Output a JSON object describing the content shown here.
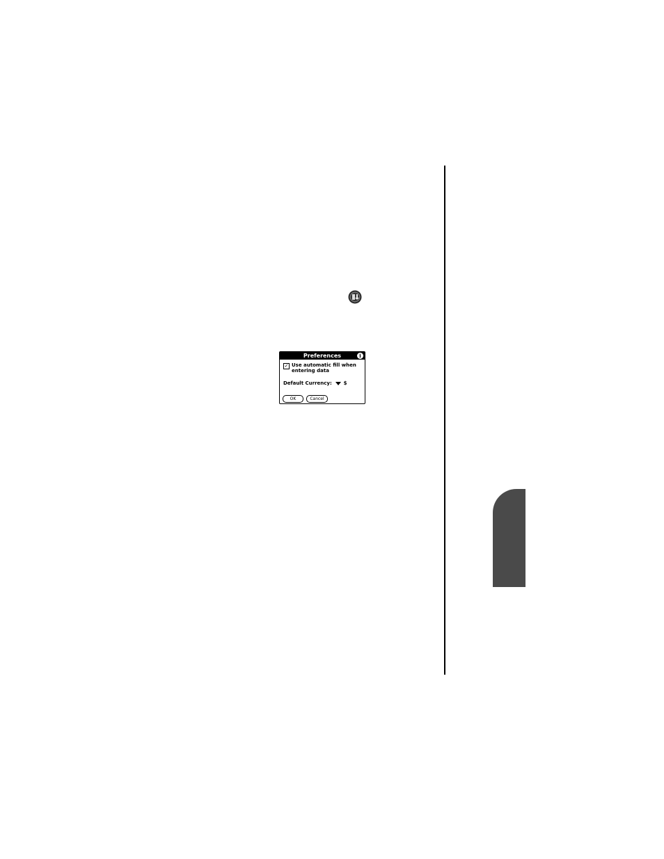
{
  "dialog": {
    "title": "Preferences",
    "info_glyph": "i",
    "autofill_checked": true,
    "autofill_check_glyph": "✓",
    "autofill_label": "Use automatic fill when entering data",
    "currency_label": "Default Currency:",
    "currency_value": "$",
    "ok_label": "OK",
    "cancel_label": "Cancel"
  },
  "icons": {
    "app_icon": "expense-app-icon",
    "info_icon": "info-icon",
    "dropdown_icon": "dropdown-triangle-icon"
  },
  "colors": {
    "tab": "#4a4a4a",
    "rule": "#000000"
  }
}
